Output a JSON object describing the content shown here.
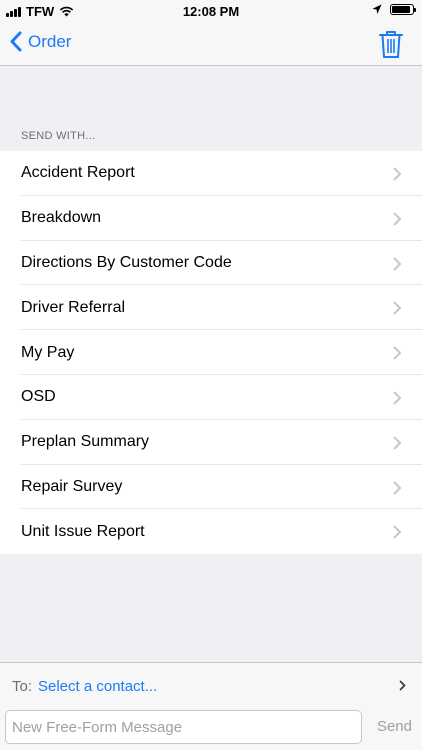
{
  "status_bar": {
    "carrier": "TFW",
    "time": "12:08 PM",
    "battery_level": 0.9
  },
  "nav": {
    "back_label": "Order",
    "back_icon": "chevron-left-icon",
    "action_icon": "trash-icon",
    "accent_color": "#1a7cf5"
  },
  "section": {
    "header": "SEND WITH..."
  },
  "list_items": [
    {
      "label": "Accident Report"
    },
    {
      "label": "Breakdown"
    },
    {
      "label": "Directions By Customer Code"
    },
    {
      "label": "Driver Referral"
    },
    {
      "label": "My Pay"
    },
    {
      "label": "OSD"
    },
    {
      "label": "Preplan Summary"
    },
    {
      "label": "Repair Survey"
    },
    {
      "label": "Unit Issue Report"
    }
  ],
  "compose": {
    "to_label": "To:",
    "contact_placeholder": "Select a contact...",
    "message_placeholder": "New Free-Form Message",
    "send_label": "Send"
  }
}
